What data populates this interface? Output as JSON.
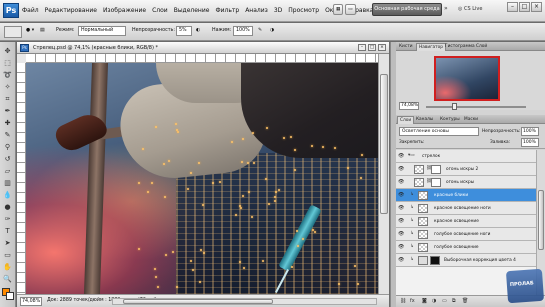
{
  "app": {
    "logo": "Ps",
    "menu": [
      "Файл",
      "Редактирование",
      "Изображение",
      "Слои",
      "Выделение",
      "Фильтр",
      "Анализ",
      "3D",
      "Просмотр",
      "Окно",
      "Справка"
    ],
    "zoom_select": "74,1",
    "workspace_button": "Основная рабочая среда",
    "cs_live": "CS Live"
  },
  "options": {
    "mode_label": "Режим:",
    "mode_value": "Нормальный",
    "opacity_label": "Непрозрачность:",
    "opacity_value": "5%",
    "flow_label": "Нажим:",
    "flow_value": "100%"
  },
  "document": {
    "title": "Стрелец.psd @ 74,1% (красные блики, RGB/8) *",
    "zoom": "74,08%",
    "info": "Док: 2889 точек/дюйм : 1889 точек (72 ppi)"
  },
  "navigator": {
    "tabs": [
      "Кисти",
      "Навигатор",
      "Гистограмма",
      "Слой"
    ],
    "active_tab": 1,
    "zoom": "74,08%"
  },
  "layers": {
    "tabs": [
      "Слои",
      "Каналы",
      "Контуры",
      "Маски"
    ],
    "active_tab": 0,
    "blend_mode": "Осветление основы",
    "opacity_label": "Непрозрачность:",
    "opacity_value": "100%",
    "lock_label": "Закрепить:",
    "fill_label": "Заливка:",
    "fill_value": "100%",
    "items": [
      {
        "name": "стрелок",
        "kind": "group",
        "selected": false
      },
      {
        "name": "огонь искры 2",
        "kind": "mask",
        "selected": false
      },
      {
        "name": "огонь искры",
        "kind": "mask",
        "selected": false
      },
      {
        "name": "красные блики",
        "kind": "pixel",
        "selected": true
      },
      {
        "name": "красное освещение ноги",
        "kind": "pixel",
        "selected": false
      },
      {
        "name": "красное освещение",
        "kind": "pixel",
        "selected": false
      },
      {
        "name": "голубое освещение ноги",
        "kind": "pixel",
        "selected": false
      },
      {
        "name": "голубое освещение",
        "kind": "pixel",
        "selected": false
      },
      {
        "name": "Выборочная коррекция цвета 4",
        "kind": "adjustment",
        "selected": false
      }
    ]
  },
  "colors": {
    "foreground": "#ff8a00",
    "background": "#ffffff",
    "selection": "#3e8edc"
  },
  "watermark": "ПРОЛАБ"
}
